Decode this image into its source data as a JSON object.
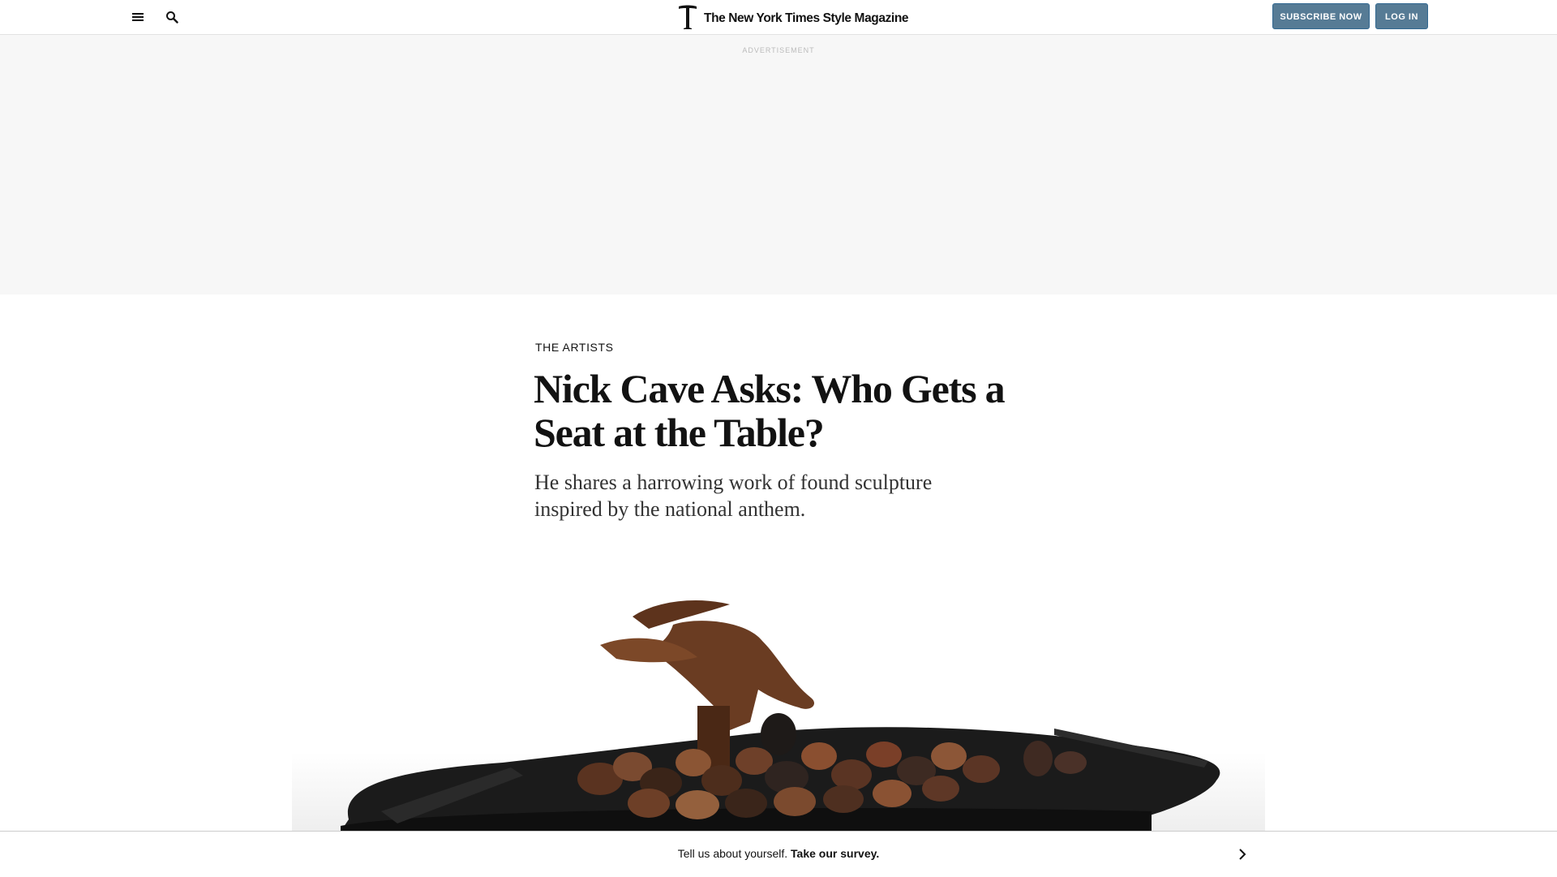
{
  "header": {
    "menu_icon": "hamburger-menu-icon",
    "search_icon": "search-icon",
    "logo_mark": "T",
    "logo_text": "The New York Times Style Magazine",
    "subscribe_label": "SUBSCRIBE NOW",
    "login_label": "LOG IN",
    "button_color": "#567b95"
  },
  "ad": {
    "label": "ADVERTISEMENT",
    "background": "#f7f7f7"
  },
  "article": {
    "kicker": "THE ARTISTS",
    "headline": "Nick Cave Asks: Who Gets a Seat at the Table?",
    "summary": "He shares a harrowing work of found sculpture inspired by the national anthem."
  },
  "survey": {
    "prompt": "Tell us about yourself.",
    "cta": "Take our survey.",
    "arrow_icon": "chevron-right-icon"
  }
}
